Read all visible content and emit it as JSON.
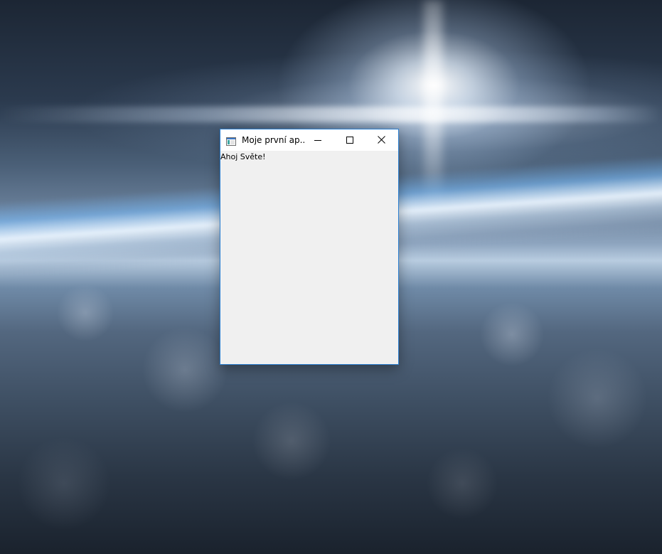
{
  "desktop": {
    "wallpaper": "earth-horizon-from-space"
  },
  "window": {
    "title": "Moje první ap...",
    "icon": "app-window-icon",
    "accent_color": "#2b7fd1",
    "controls": {
      "minimize_icon": "minimize-icon",
      "maximize_icon": "maximize-icon",
      "close_icon": "close-icon"
    },
    "client": {
      "label_text": "Ahoj Světe!",
      "background": "#f0f0f0"
    }
  }
}
